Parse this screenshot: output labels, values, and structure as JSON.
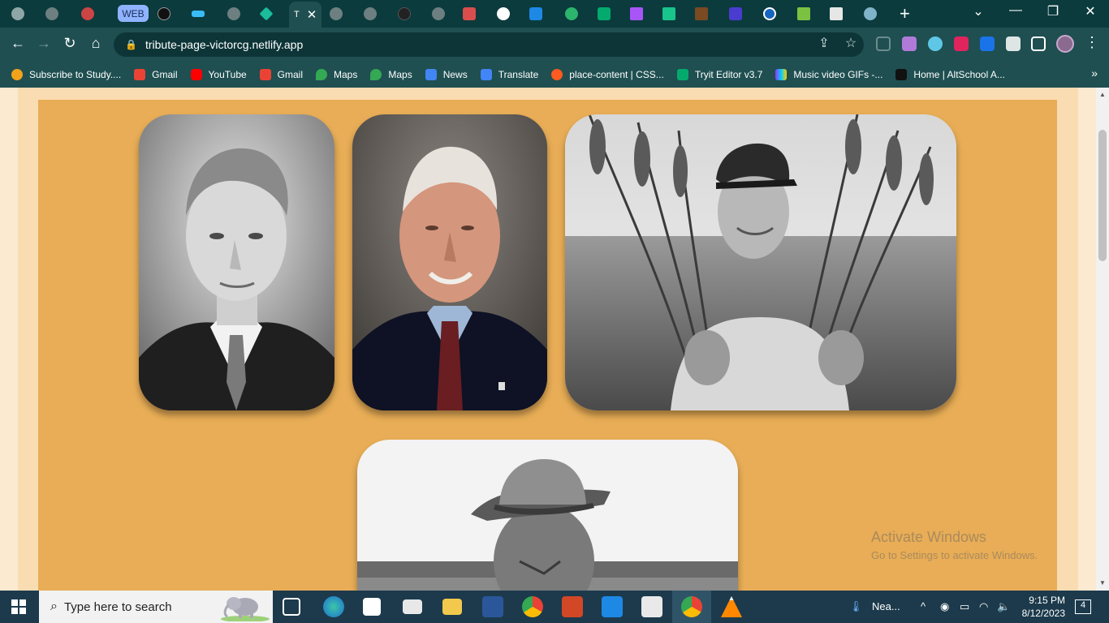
{
  "browser": {
    "active_tab_title": "T",
    "web_tab_chip": "WEB",
    "address": "tribute-page-victorcg.netlify.app"
  },
  "bookmarks": [
    {
      "label": "Subscribe to Study....",
      "icon": "ring-icon",
      "color": "#f2a31b"
    },
    {
      "label": "Gmail",
      "icon": "gmail-icon",
      "color": "#ea4335"
    },
    {
      "label": "YouTube",
      "icon": "youtube-icon",
      "color": "#ff0000"
    },
    {
      "label": "Gmail",
      "icon": "gmail-icon",
      "color": "#ea4335"
    },
    {
      "label": "Maps",
      "icon": "maps-pin-icon",
      "color": "#34a853"
    },
    {
      "label": "Maps",
      "icon": "maps-pin-icon",
      "color": "#34a853"
    },
    {
      "label": "News",
      "icon": "news-icon",
      "color": "#4285f4"
    },
    {
      "label": "Translate",
      "icon": "translate-icon",
      "color": "#4285f4"
    },
    {
      "label": "place-content | CSS...",
      "icon": "asterisk-icon",
      "color": "#ff5a1f"
    },
    {
      "label": "Tryit Editor v3.7",
      "icon": "w3-icon",
      "color": "#04aa6d"
    },
    {
      "label": "Music video GIFs -...",
      "icon": "giphy-icon",
      "color": "#9933ff"
    },
    {
      "label": "Home | AltSchool A...",
      "icon": "altschool-icon",
      "color": "#111111"
    }
  ],
  "watermark": {
    "line1": "Activate Windows",
    "line2": "Go to Settings to activate Windows."
  },
  "taskbar": {
    "search_placeholder": "Type here to search",
    "weather": "Nea...",
    "time": "9:15 PM",
    "date": "8/12/2023",
    "notifications": "4"
  },
  "colors": {
    "page_background": "#fbe9d0",
    "panel_background": "#e8ad56",
    "browser_chrome": "#1f4f51"
  }
}
